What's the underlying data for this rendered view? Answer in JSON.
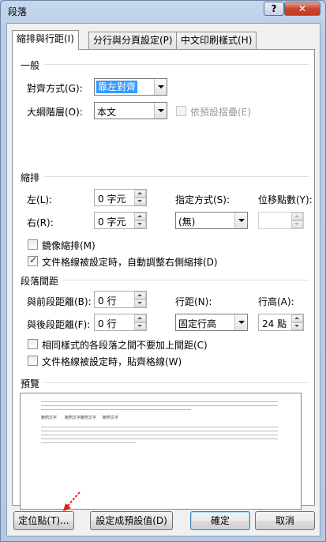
{
  "window": {
    "title": "段落",
    "help_label": "?",
    "close_label": "✕"
  },
  "tabs": [
    {
      "label": "縮排與行距(I)",
      "active": true
    },
    {
      "label": "分行與分頁設定(P)",
      "active": false
    },
    {
      "label": "中文印刷樣式(H)",
      "active": false
    }
  ],
  "general": {
    "title": "一般",
    "alignment_label": "對齊方式(G):",
    "alignment_value": "靠左對齊",
    "outline_label": "大綱階層(O):",
    "outline_value": "本文",
    "collapse_label": "依預設摺疊(E)"
  },
  "indent": {
    "title": "縮排",
    "left_label": "左(L):",
    "left_value": "0 字元",
    "right_label": "右(R):",
    "right_value": "0 字元",
    "special_label": "指定方式(S):",
    "special_value": "(無)",
    "by_label": "位移點數(Y):",
    "by_value": "",
    "mirror_label": "鏡像縮排(M)",
    "auto_adjust_label": "文件格線被設定時，自動調整右側縮排(D)",
    "auto_adjust_checked": true
  },
  "spacing": {
    "title": "段落間距",
    "before_label": "與前段距離(B):",
    "before_value": "0 行",
    "after_label": "與後段距離(F):",
    "after_value": "0 行",
    "line_spacing_label": "行距(N):",
    "line_spacing_value": "固定行高",
    "at_label": "行高(A):",
    "at_value": "24 點",
    "no_space_label": "相同樣式的各段落之間不要加上間距(C)",
    "snap_grid_label": "文件格線被設定時，貼齊格線(W)"
  },
  "preview": {
    "title": "預覽",
    "sample_words": [
      "範例文字",
      "範例文字範例文字",
      "範例文字"
    ]
  },
  "buttons": {
    "tabs_label": "定位點(T)...",
    "default_label": "設定成預設值(D)",
    "ok_label": "確定",
    "cancel_label": "取消"
  },
  "colors": {
    "selection": "#3399ff",
    "annotation_arrow": "#e0201a"
  }
}
